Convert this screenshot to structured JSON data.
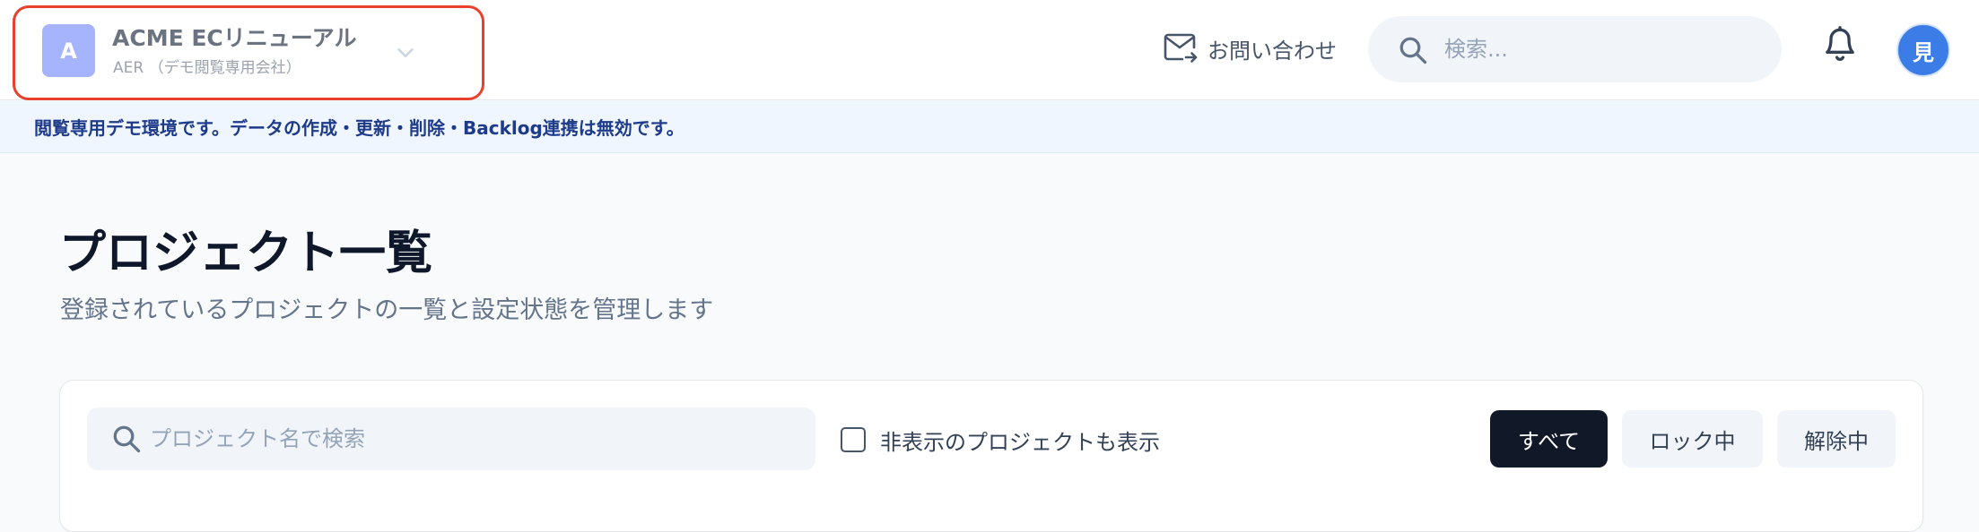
{
  "header": {
    "project": {
      "avatar_letter": "A",
      "name": "ACME ECリニューアル",
      "subtitle": "AER （デモ閲覧専用会社）",
      "avatar_color": "#a5b4fc",
      "highlight_color": "#e8402d"
    },
    "contact_label": "お問い合わせ",
    "search": {
      "placeholder": "検索...",
      "value": ""
    },
    "user_avatar": {
      "letter": "見",
      "color": "#3b7ce6"
    }
  },
  "banner": {
    "text": "閲覧専用デモ環境です。データの作成・更新・削除・Backlog連携は無効です。"
  },
  "page": {
    "title": "プロジェクト一覧",
    "subtitle": "登録されているプロジェクトの一覧と設定状態を管理します"
  },
  "filters": {
    "search_placeholder": "プロジェクト名で検索",
    "search_value": "",
    "show_hidden_label": "非表示のプロジェクトも表示",
    "show_hidden_checked": false,
    "segments": [
      {
        "label": "すべて",
        "active": true
      },
      {
        "label": "ロック中",
        "active": false
      },
      {
        "label": "解除中",
        "active": false
      }
    ]
  },
  "icons": {
    "chevron": "chevron-down-icon",
    "mail": "mail-forward-icon",
    "search": "search-icon",
    "bell": "bell-icon"
  }
}
